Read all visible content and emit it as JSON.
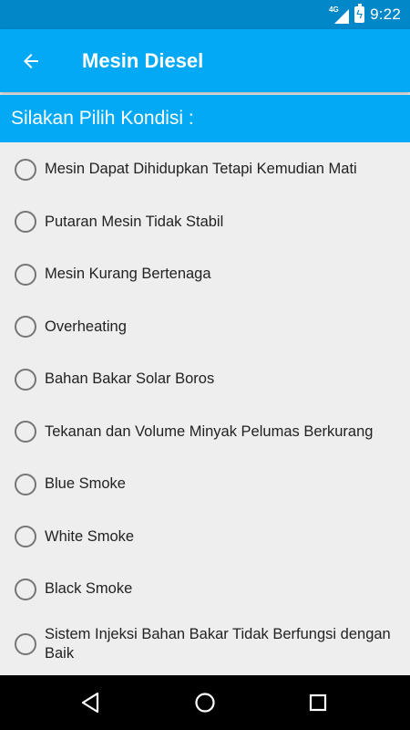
{
  "status_bar": {
    "network": "4G",
    "time": "9:22"
  },
  "app_bar": {
    "title": "Mesin Diesel",
    "back_icon": "arrow-back-icon"
  },
  "section": {
    "title": "Silakan Pilih Kondisi :"
  },
  "options": [
    {
      "label": "Mesin Dapat Dihidupkan Tetapi Kemudian Mati",
      "selected": false
    },
    {
      "label": "Putaran Mesin Tidak Stabil",
      "selected": false
    },
    {
      "label": "Mesin Kurang Bertenaga",
      "selected": false
    },
    {
      "label": "Overheating",
      "selected": false
    },
    {
      "label": "Bahan Bakar Solar Boros",
      "selected": false
    },
    {
      "label": "Tekanan dan Volume Minyak Pelumas Berkurang",
      "selected": false
    },
    {
      "label": "Blue Smoke",
      "selected": false
    },
    {
      "label": "White Smoke",
      "selected": false
    },
    {
      "label": "Black Smoke",
      "selected": false
    },
    {
      "label": "Sistem Injeksi Bahan Bakar Tidak Berfungsi dengan Baik",
      "selected": false
    }
  ],
  "nav_bar": {
    "back_icon": "nav-back-icon",
    "home_icon": "nav-home-icon",
    "recents_icon": "nav-recents-icon"
  },
  "colors": {
    "status_bar": "#0287c8",
    "primary": "#03a9f4",
    "background": "#eeeeee",
    "radio_border": "#757575"
  }
}
